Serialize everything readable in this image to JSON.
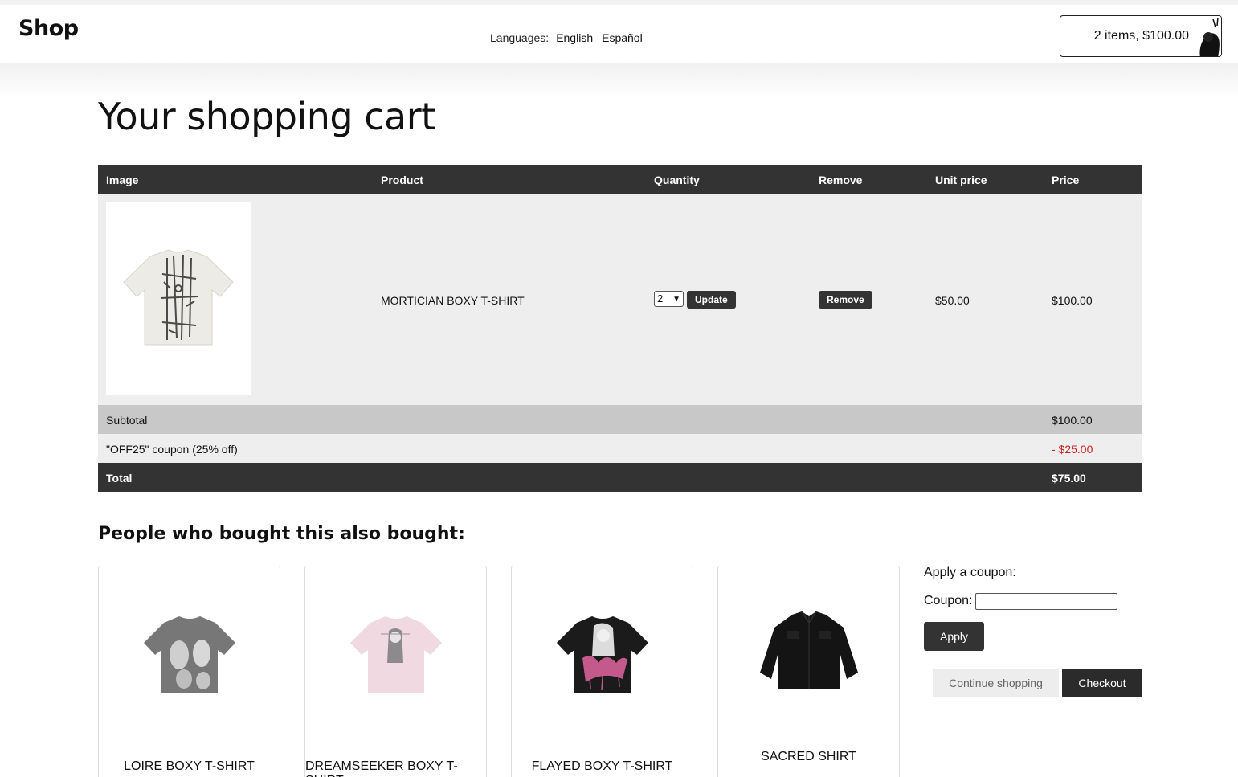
{
  "header": {
    "logo": "Shop",
    "languages_label": "Languages:",
    "languages": [
      "English",
      "Español"
    ],
    "cart_summary": "2 items, $100.00"
  },
  "page_title": "Your shopping cart",
  "table": {
    "columns": [
      "Image",
      "Product",
      "Quantity",
      "Remove",
      "Unit price",
      "Price"
    ],
    "items": [
      {
        "image_icon": "t-shirt-image",
        "product": "MORTICIAN BOXY T-SHIRT",
        "quantity": "2",
        "update_label": "Update",
        "remove_label": "Remove",
        "unit_price": "$50.00",
        "price": "$100.00"
      }
    ],
    "subtotal_label": "Subtotal",
    "subtotal": "$100.00",
    "coupon_label": "\"OFF25\" coupon (25% off)",
    "coupon_discount": "- $25.00",
    "total_label": "Total",
    "total": "$75.00"
  },
  "also_bought": {
    "title": "People who bought this also bought:",
    "products": [
      {
        "name": "LOIRE BOXY T-SHIRT",
        "image_icon": "grey-t-shirt-image"
      },
      {
        "name": "DREAMSEEKER BOXY T-SHIRT",
        "image_icon": "pink-t-shirt-image"
      },
      {
        "name": "FLAYED BOXY T-SHIRT",
        "image_icon": "black-t-shirt-image"
      },
      {
        "name": "SACRED SHIRT",
        "image_icon": "black-shirt-image"
      }
    ]
  },
  "coupon_form": {
    "title": "Apply a coupon:",
    "label": "Coupon:",
    "value": "",
    "apply_label": "Apply"
  },
  "actions": {
    "continue_label": "Continue shopping",
    "checkout_label": "Checkout"
  },
  "colors": {
    "dark": "#333333",
    "row_bg": "#eeeeee",
    "subtotal_bg": "#c8c8c8",
    "discount": "#cc2222"
  }
}
